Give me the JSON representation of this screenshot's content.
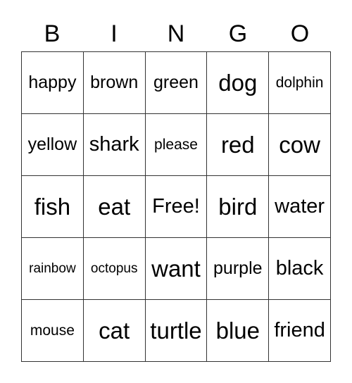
{
  "header": [
    "B",
    "I",
    "N",
    "G",
    "O"
  ],
  "rows": [
    [
      "happy",
      "brown",
      "green",
      "dog",
      "dolphin"
    ],
    [
      "yellow",
      "shark",
      "please",
      "red",
      "cow"
    ],
    [
      "fish",
      "eat",
      "Free!",
      "bird",
      "water"
    ],
    [
      "rainbow",
      "octopus",
      "want",
      "purple",
      "black"
    ],
    [
      "mouse",
      "cat",
      "turtle",
      "blue",
      "friend"
    ]
  ]
}
